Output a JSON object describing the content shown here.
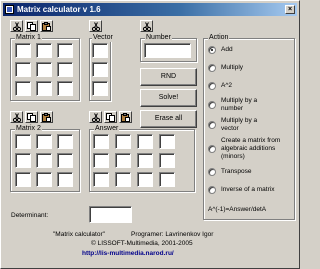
{
  "window": {
    "title": "Matrix calculator v 1.6",
    "close_glyph": "×"
  },
  "groups": {
    "matrix1": "Matrix 1",
    "vector": "Vector",
    "number": "Number",
    "matrix2": "Matrix 2",
    "answer": "Answer",
    "action": "Action"
  },
  "buttons": {
    "rnd": "RND",
    "solve": "Solve!",
    "erase": "Erase all"
  },
  "actions": [
    {
      "label": "Add",
      "selected": true
    },
    {
      "label": "Multiply",
      "selected": false
    },
    {
      "label": "A^2",
      "selected": false
    },
    {
      "label": "Multiply by a number",
      "selected": false
    },
    {
      "label": "Multiply by a vector",
      "selected": false
    },
    {
      "label": "Create a matrix from algebraic additions (minors)",
      "selected": false
    },
    {
      "label": "Transpose",
      "selected": false
    },
    {
      "label": "Inverse of a matrix",
      "selected": false
    }
  ],
  "formula": "A^(-1)=Answer/detA",
  "determinant_label": "Determinant:",
  "footer": {
    "line1_a": "\"Matrix calculator\"",
    "line1_b": "Programer: Lavrinenkov Igor",
    "line2": "© LISSOFT-Multimedia, 2001-2005",
    "link": "http://lis-multimedia.narod.ru/"
  },
  "icons": {
    "cut": "scissors-icon",
    "copy": "copy-icon",
    "paste": "paste-icon"
  }
}
